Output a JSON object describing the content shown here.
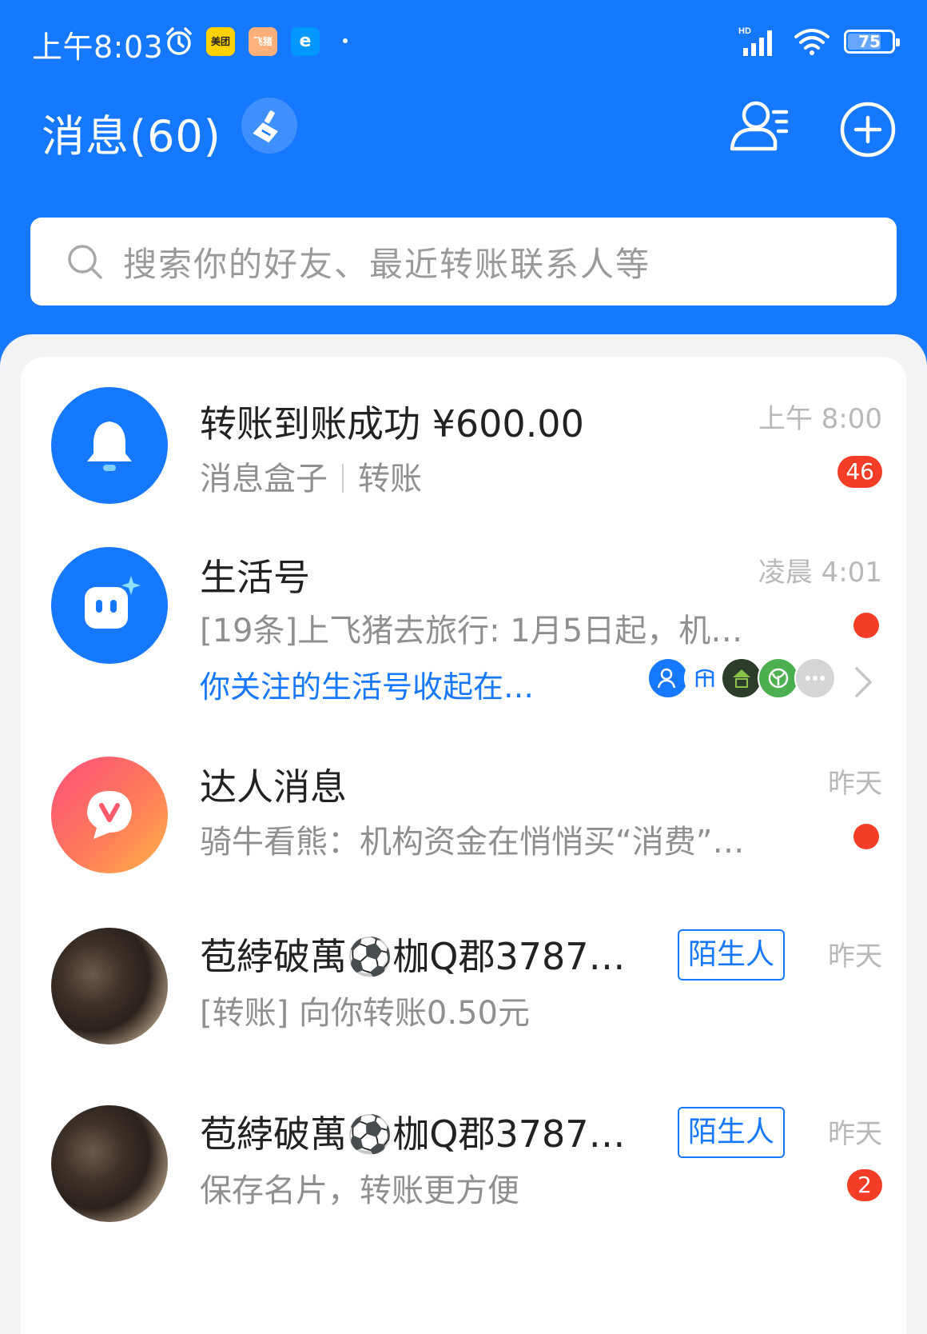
{
  "status_bar": {
    "time": "上午8:03",
    "apps": [
      "美团",
      "飞猪",
      "e"
    ],
    "battery": "75",
    "battery_level_percent": 75,
    "network": "HD"
  },
  "header": {
    "title": "消息(60)",
    "clean_icon": "broom-icon",
    "contacts_icon": "contacts-icon",
    "add_icon": "plus-circle-icon"
  },
  "search": {
    "placeholder": "搜索你的好友、最近转账联系人等"
  },
  "messages": [
    {
      "title": "转账到账成功 ¥600.00",
      "subtitle_source": "消息盒子",
      "subtitle_type": "转账",
      "time": "上午 8:00",
      "badge": "46",
      "icon": "bell-icon"
    },
    {
      "title": "生活号",
      "subtitle": "[19条]上飞猪去旅行: 1月5日起，机…",
      "time": "凌晨 4:01",
      "follow_text": "你关注的生活号收起在…",
      "icon": "life-account-icon"
    },
    {
      "title": "达人消息",
      "subtitle": "骑牛看熊：机构资金在悄悄买“消费”…",
      "time": "昨天",
      "icon": "v-chat-icon"
    },
    {
      "title": "苞綍破萬⚽枷Q郡3787…",
      "tag": "陌生人",
      "subtitle": "[转账] 向你转账0.50元",
      "time": "昨天"
    },
    {
      "title": "苞綍破萬⚽枷Q郡3787…",
      "tag": "陌生人",
      "subtitle": "保存名片，转账更方便",
      "time": "昨天",
      "badge": "2"
    }
  ],
  "colors": {
    "brand_blue": "#1677ff",
    "badge_red": "#f43d27"
  }
}
